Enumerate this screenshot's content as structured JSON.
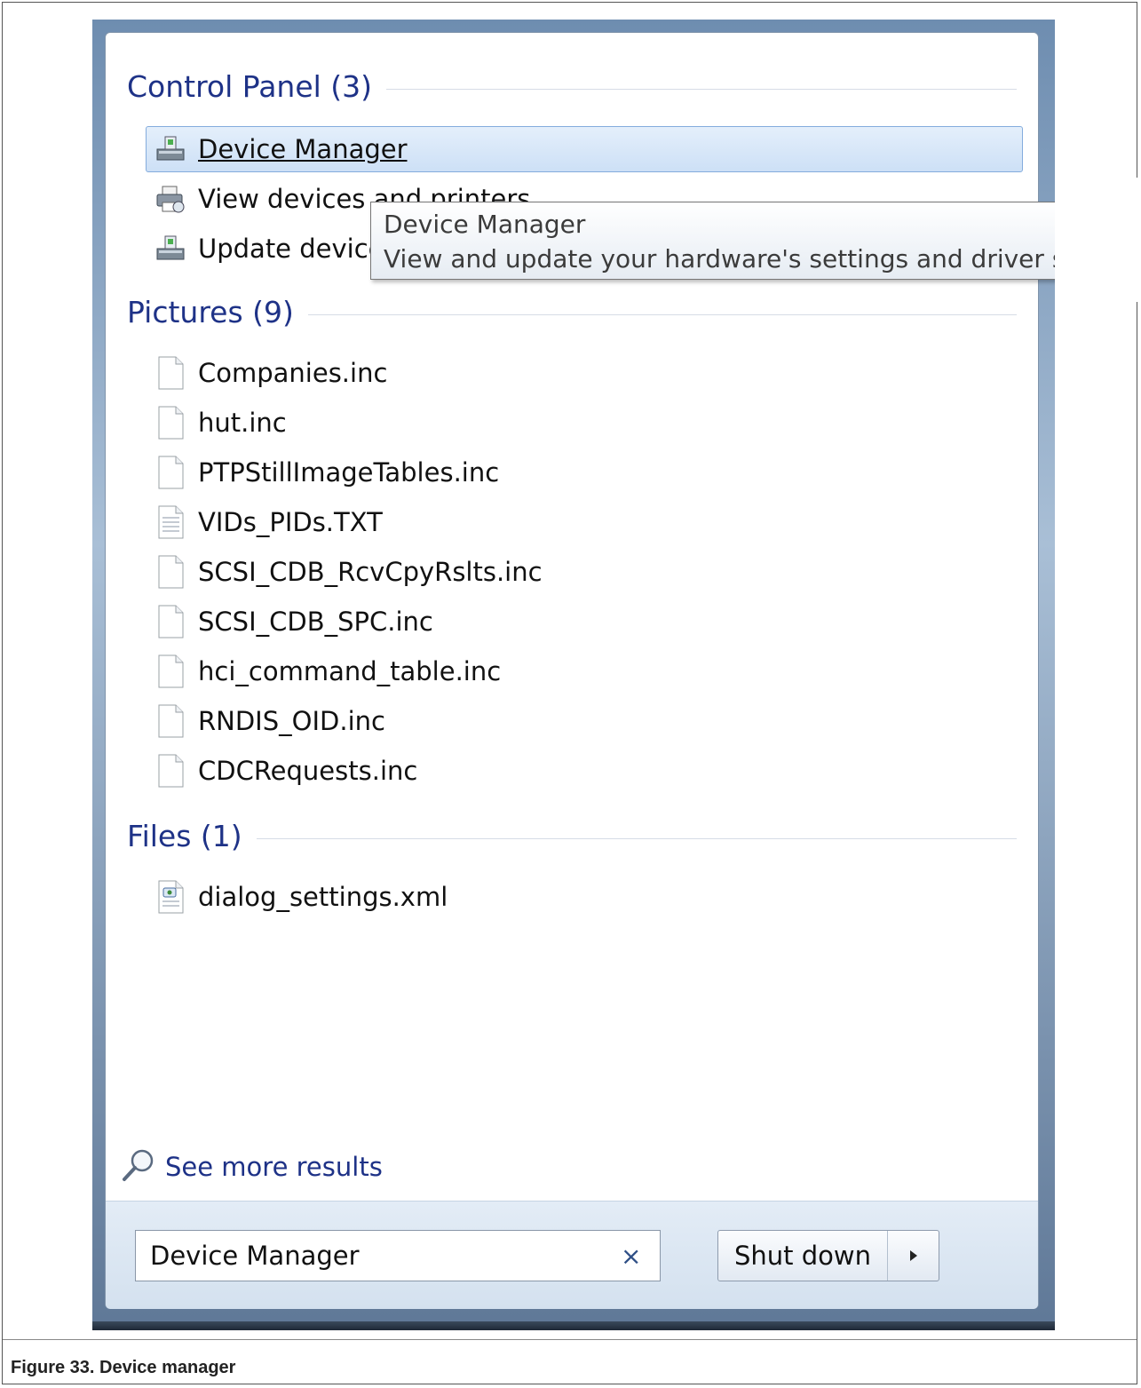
{
  "control_panel": {
    "header": "Control Panel (3)",
    "items": [
      {
        "label": "Device Manager",
        "icon": "device-manager-icon",
        "selected": true
      },
      {
        "label": "View devices and printers",
        "icon": "printer-icon",
        "selected": false
      },
      {
        "label": "Update device drivers",
        "icon": "device-manager-icon",
        "selected": false
      }
    ]
  },
  "tooltip": {
    "title": "Device Manager",
    "description": "View and update your hardware's settings and driver software."
  },
  "pictures": {
    "header": "Pictures (9)",
    "items": [
      {
        "label": "Companies.inc",
        "icon": "file-icon"
      },
      {
        "label": "hut.inc",
        "icon": "file-icon"
      },
      {
        "label": "PTPStillImageTables.inc",
        "icon": "file-icon"
      },
      {
        "label": "VIDs_PIDs.TXT",
        "icon": "text-file-icon"
      },
      {
        "label": "SCSI_CDB_RcvCpyRslts.inc",
        "icon": "file-icon"
      },
      {
        "label": "SCSI_CDB_SPC.inc",
        "icon": "file-icon"
      },
      {
        "label": "hci_command_table.inc",
        "icon": "file-icon"
      },
      {
        "label": "RNDIS_OID.inc",
        "icon": "file-icon"
      },
      {
        "label": "CDCRequests.inc",
        "icon": "file-icon"
      }
    ]
  },
  "files": {
    "header": "Files (1)",
    "items": [
      {
        "label": "dialog_settings.xml",
        "icon": "xml-file-icon"
      }
    ]
  },
  "see_more": "See more results",
  "search": {
    "value": "Device Manager",
    "clear_symbol": "×"
  },
  "shutdown": {
    "label": "Shut down"
  },
  "caption": "Figure 33. Device manager",
  "colors": {
    "header_text": "#1e3287",
    "selection": "#cde0f6"
  }
}
